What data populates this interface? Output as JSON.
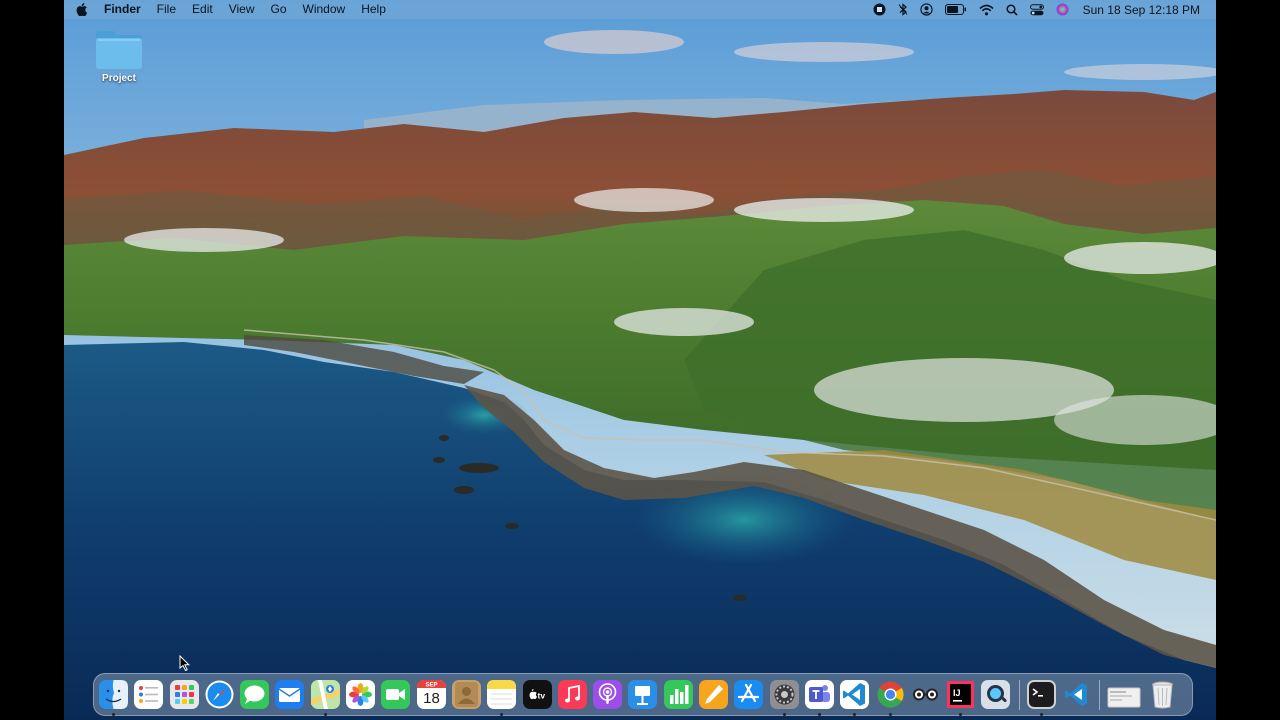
{
  "menubar": {
    "app_name": "Finder",
    "menus": [
      "File",
      "Edit",
      "View",
      "Go",
      "Window",
      "Help"
    ],
    "clock": "Sun 18 Sep  12:18 PM"
  },
  "desktop": {
    "items": [
      {
        "label": "Project",
        "icon": "folder-icon"
      }
    ]
  },
  "dock": {
    "calendar": {
      "month": "SEP",
      "day": "18"
    },
    "apps": [
      "Finder",
      "Reminders",
      "Launchpad",
      "Safari",
      "Messages",
      "Mail",
      "Maps",
      "Photos",
      "FaceTime",
      "Calendar",
      "Contacts",
      "Notes",
      "TV",
      "Music",
      "Podcasts",
      "Keynote",
      "Numbers",
      "Pages",
      "App Store",
      "System Preferences",
      "Microsoft Teams",
      "Visual Studio Code",
      "Google Chrome",
      "Charles Proxy",
      "IntelliJ IDEA",
      "Proxyman",
      "Terminal",
      "Visual Studio Code",
      "Downloads",
      "Trash"
    ],
    "tv_label": "tv"
  },
  "colors": {
    "sky": "#8cbde2",
    "ocean": "#0f3d6e",
    "menubar": "#78aad7",
    "folder": "#5fb4e6"
  }
}
